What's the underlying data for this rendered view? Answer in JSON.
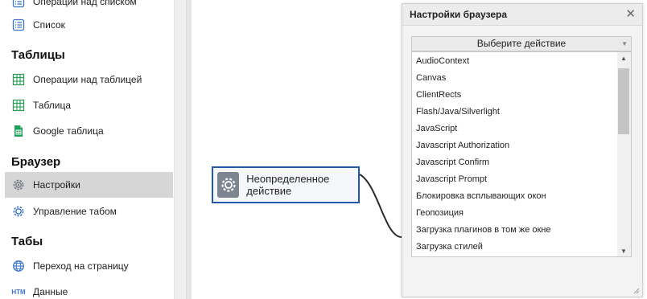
{
  "sidebar": {
    "items": [
      {
        "label": "Операции над списком",
        "icon": "list-icon"
      },
      {
        "label": "Список",
        "icon": "list-icon"
      },
      {
        "label": "Операции над таблицей",
        "icon": "table-icon"
      },
      {
        "label": "Таблица",
        "icon": "table-icon"
      },
      {
        "label": "Google таблица",
        "icon": "google-sheet-icon"
      },
      {
        "label": "Настройки",
        "icon": "gear-icon"
      },
      {
        "label": "Управление табом",
        "icon": "gear-icon"
      },
      {
        "label": "Переход на страницу",
        "icon": "globe-icon"
      },
      {
        "label": "Данные",
        "icon": "html-icon"
      }
    ],
    "sections": {
      "tables": "Таблицы",
      "browser": "Браузер",
      "tabs": "Табы"
    },
    "html_icon_text": "HTM",
    "active_item": "Настройки"
  },
  "canvas": {
    "node": {
      "label": "Неопределенное действие",
      "icon": "gear-icon"
    }
  },
  "dialog": {
    "title": "Настройки браузера",
    "close_glyph": "✕",
    "select_value": "Выберите действие",
    "options": [
      "AudioContext",
      "Canvas",
      "ClientRects",
      "Flash/Java/Silverlight",
      "JavaScript",
      "Javascript Authorization",
      "Javascript Confirm",
      "Javascript Prompt",
      "Блокировка всплывающих окон",
      "Геопозиция",
      "Загрузка плагинов в том же окне",
      "Загрузка стилей"
    ]
  },
  "colors": {
    "accent": "#1e5aa8",
    "table_icon": "#2e9e5a",
    "list_icon": "#3a74c9"
  }
}
